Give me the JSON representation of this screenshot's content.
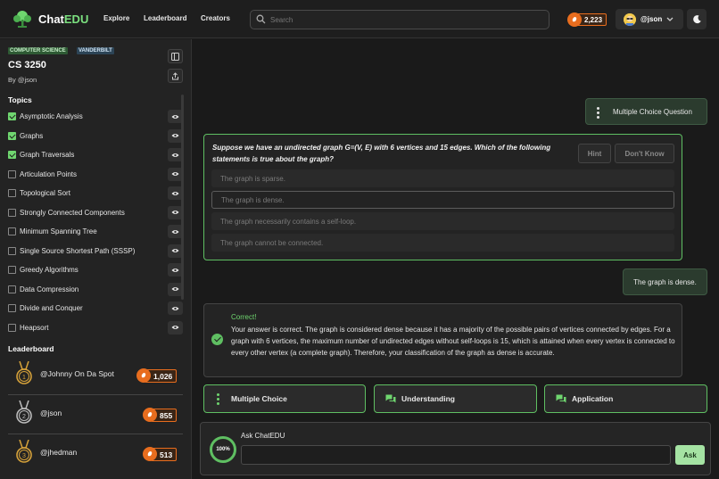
{
  "header": {
    "brand_prefix": "Chat",
    "brand_suffix": "EDU",
    "nav": [
      "Explore",
      "Leaderboard",
      "Creators"
    ],
    "search_placeholder": "Search",
    "coins": "2,223",
    "username": "@json"
  },
  "sidebar": {
    "tags": [
      "COMPUTER SCIENCE",
      "VANDERBILT"
    ],
    "course_code": "CS 3250",
    "by_prefix": "By",
    "by_user": "@json",
    "topics_heading": "Topics",
    "topics": [
      {
        "label": "Asymptotic Analysis",
        "checked": true
      },
      {
        "label": "Graphs",
        "checked": true
      },
      {
        "label": "Graph Traversals",
        "checked": true
      },
      {
        "label": "Articulation Points",
        "checked": false
      },
      {
        "label": "Topological Sort",
        "checked": false
      },
      {
        "label": "Strongly Connected Components",
        "checked": false
      },
      {
        "label": "Minimum Spanning Tree",
        "checked": false
      },
      {
        "label": "Single Source Shortest Path (SSSP)",
        "checked": false
      },
      {
        "label": "Greedy Algorithms",
        "checked": false
      },
      {
        "label": "Data Compression",
        "checked": false
      },
      {
        "label": "Divide and Conquer",
        "checked": false
      },
      {
        "label": "Heapsort",
        "checked": false
      }
    ],
    "leaderboard_heading": "Leaderboard",
    "leaderboard": [
      {
        "rank": "1",
        "name": "@Johnny On Da Spot",
        "score": "1,026"
      },
      {
        "rank": "2",
        "name": "@json",
        "score": "855"
      },
      {
        "rank": "3",
        "name": "@jhedman",
        "score": "513"
      }
    ]
  },
  "chat": {
    "mcq_bubble": "Multiple Choice Question",
    "question": "Suppose we have an undirected graph G=(V, E) with 6 vertices and 15 edges. Which of the following statements is true about the graph?",
    "hint_label": "Hint",
    "dont_know_label": "Don't Know",
    "options": [
      "The graph is sparse.",
      "The graph is dense.",
      "The graph necessarily contains a self-loop.",
      "The graph cannot be connected."
    ],
    "selected_option": "The graph is dense.",
    "user_answer": "The graph is dense.",
    "feedback_title": "Correct!",
    "feedback_text": "Your answer is correct. The graph is considered dense because it has a majority of the possible pairs of vertices connected by edges. For a graph with 6 vertices, the maximum number of undirected edges without self-loops is 15, which is attained when every vertex is connected to every other vertex (a complete graph). Therefore, your classification of the graph as dense is accurate.",
    "followups": [
      "Multiple Choice",
      "Understanding",
      "Application"
    ],
    "progress": "100%",
    "ask_label": "Ask ChatEDU",
    "ask_button": "Ask"
  },
  "colors": {
    "accent_green": "#5fbf62",
    "coin_orange": "#e86d1e",
    "background": "#1a1a1a"
  }
}
